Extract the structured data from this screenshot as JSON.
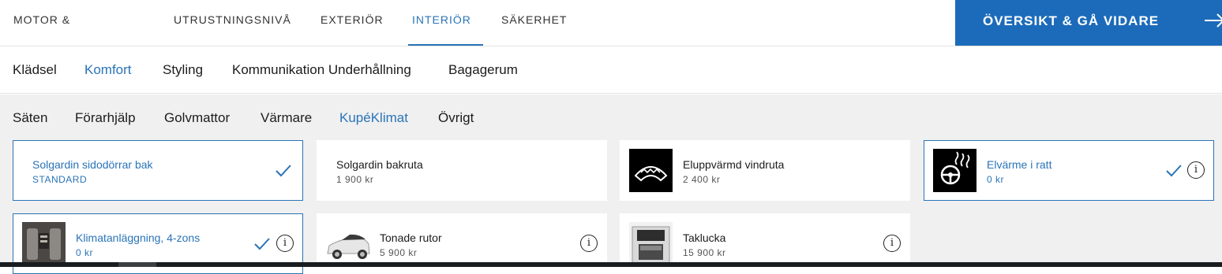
{
  "step_tabs": [
    "MOTOR & VÄXELLÅDA",
    "UTRUSTNINGSNIVÅ",
    "EXTERIÖR",
    "INTERIÖR",
    "SÄKERHET"
  ],
  "cta_label": "ÖVERSIKT & GÅ VIDARE",
  "categories": [
    "Klädsel",
    "Komfort",
    "Styling",
    "Kommunikation Underhållning",
    "Bagagerum"
  ],
  "subcategories": [
    "Säten",
    "Förarhjälp",
    "Golvmattor",
    "Värmare",
    "KupéKlimat",
    "Övrigt"
  ],
  "active": {
    "step_tab": "INTERIÖR",
    "category": "Komfort",
    "subcategory": "KupéKlimat"
  },
  "options": [
    {
      "title": "Solgardin sidodörrar bak",
      "price": "STANDARD",
      "selected": true,
      "icon": "sunshade-side-icon"
    },
    {
      "title": "Solgardin bakruta",
      "price": "1 900 kr",
      "selected": false,
      "icon": ""
    },
    {
      "title": "Eluppvärmd vindruta",
      "price": "2 400 kr",
      "selected": false,
      "icon": "heated-windscreen-icon"
    },
    {
      "title": "Elvärme i ratt",
      "price": "0 kr",
      "selected": true,
      "icon": "heated-steering-wheel-icon"
    },
    {
      "title": "Klimatanläggning, 4-zons",
      "price": "0 kr",
      "selected": true,
      "icon": "climate-zone-photo"
    },
    {
      "title": "Tonade rutor",
      "price": "5 900 kr",
      "selected": false,
      "icon": "tinted-windows-photo"
    },
    {
      "title": "Taklucka",
      "price": "15 900 kr",
      "selected": false,
      "icon": "sunroof-photo"
    }
  ],
  "info_glyph": "i",
  "colors": {
    "accent": "#2a74b8",
    "cta_bg": "#1c6bba",
    "content_bg": "#f0f0f0"
  }
}
